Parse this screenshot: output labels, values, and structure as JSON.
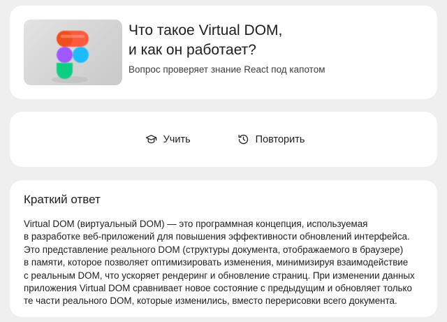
{
  "question": {
    "title": "Что такое Virtual DOM,\nи как он работает?",
    "subtitle": "Вопрос проверяет знание React под капотом",
    "image_icon": "figma-logo",
    "logo_colors": {
      "red": "#ff5a3c",
      "orange": "#ff8a5c",
      "purple": "#a259ff",
      "blue": "#1abcfe",
      "green": "#0acf83"
    }
  },
  "actions": {
    "learn": {
      "label": "Учить",
      "icon": "graduation-cap-icon"
    },
    "repeat": {
      "label": "Повторить",
      "icon": "history-icon"
    }
  },
  "answer": {
    "heading": "Краткий ответ",
    "text": "Virtual DOM (виртуальный DOM) — это программная концепция, используемая\nв разработке веб-приложений для повышения эффективности обновлений интерфейса.\nЭто представление реального DOM (структуры документа, отображаемого в браузере)\nв памяти, которое позволяет оптимизировать изменения, минимизируя взаимодействие\nс реальным DOM, что ускоряет рендеринг и обновление страниц. При изменении данных\nприложения Virtual DOM сравнивает новое состояние с предыдущим и обновляет только\nте части реального DOM, которые изменились, вместо перерисовки всего документа."
  }
}
